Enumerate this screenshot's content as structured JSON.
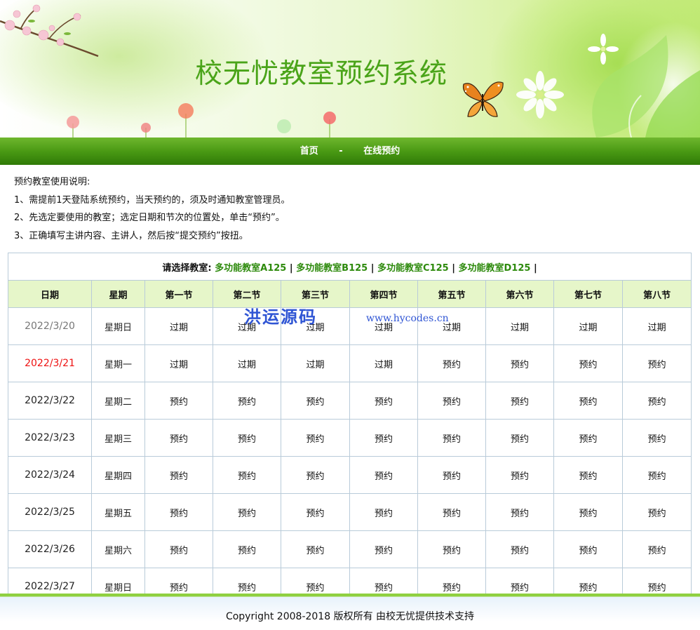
{
  "header": {
    "title": "校无忧教室预约系统"
  },
  "nav": {
    "home": "首页",
    "separator": "-",
    "booking": "在线预约"
  },
  "instructions": {
    "heading": "预约教室使用说明:",
    "lines": [
      "1、需提前1天登陆系统预约，当天预约的，须及时通知教室管理员。",
      "2、先选定要使用的教室；选定日期和节次的位置处，单击“预约”。",
      "3、正确填写主讲内容、主讲人，然后按“提交预约”按扭。"
    ]
  },
  "room_select": {
    "label": "请选择教室:",
    "rooms": [
      "多功能教室A125",
      "多功能教室B125",
      "多功能教室C125",
      "多功能教室D125"
    ],
    "divider": "|"
  },
  "table": {
    "headers": [
      "日期",
      "星期",
      "第一节",
      "第二节",
      "第三节",
      "第四节",
      "第五节",
      "第六节",
      "第七节",
      "第八节"
    ],
    "rows": [
      {
        "date": "2022/3/20",
        "weekday": "星期日",
        "status": "past",
        "slots": [
          "过期",
          "过期",
          "过期",
          "过期",
          "过期",
          "过期",
          "过期",
          "过期"
        ]
      },
      {
        "date": "2022/3/21",
        "weekday": "星期一",
        "status": "today",
        "slots": [
          "过期",
          "过期",
          "过期",
          "过期",
          "预约",
          "预约",
          "预约",
          "预约"
        ]
      },
      {
        "date": "2022/3/22",
        "weekday": "星期二",
        "status": "future",
        "slots": [
          "预约",
          "预约",
          "预约",
          "预约",
          "预约",
          "预约",
          "预约",
          "预约"
        ]
      },
      {
        "date": "2022/3/23",
        "weekday": "星期三",
        "status": "future",
        "slots": [
          "预约",
          "预约",
          "预约",
          "预约",
          "预约",
          "预约",
          "预约",
          "预约"
        ]
      },
      {
        "date": "2022/3/24",
        "weekday": "星期四",
        "status": "future",
        "slots": [
          "预约",
          "预约",
          "预约",
          "预约",
          "预约",
          "预约",
          "预约",
          "预约"
        ]
      },
      {
        "date": "2022/3/25",
        "weekday": "星期五",
        "status": "future",
        "slots": [
          "预约",
          "预约",
          "预约",
          "预约",
          "预约",
          "预约",
          "预约",
          "预约"
        ]
      },
      {
        "date": "2022/3/26",
        "weekday": "星期六",
        "status": "future",
        "slots": [
          "预约",
          "预约",
          "预约",
          "预约",
          "预约",
          "预约",
          "预约",
          "预约"
        ]
      },
      {
        "date": "2022/3/27",
        "weekday": "星期日",
        "status": "future",
        "slots": [
          "预约",
          "预约",
          "预约",
          "预约",
          "预约",
          "预约",
          "预约",
          "预约"
        ]
      }
    ]
  },
  "watermark": {
    "brand": "洪运源码",
    "url": "www.hycodes.cn"
  },
  "footer": {
    "copyright": "Copyright 2008-2018 版权所有 由校无忧提供技术支持"
  },
  "colors": {
    "title_green": "#4aa419",
    "nav_green": "#4a9a14",
    "header_row_bg": "#e6f6c9",
    "room_link": "#2d8a0c",
    "today_date": "#ee1111",
    "past_date": "#777777",
    "watermark_blue": "#2f55d4"
  }
}
